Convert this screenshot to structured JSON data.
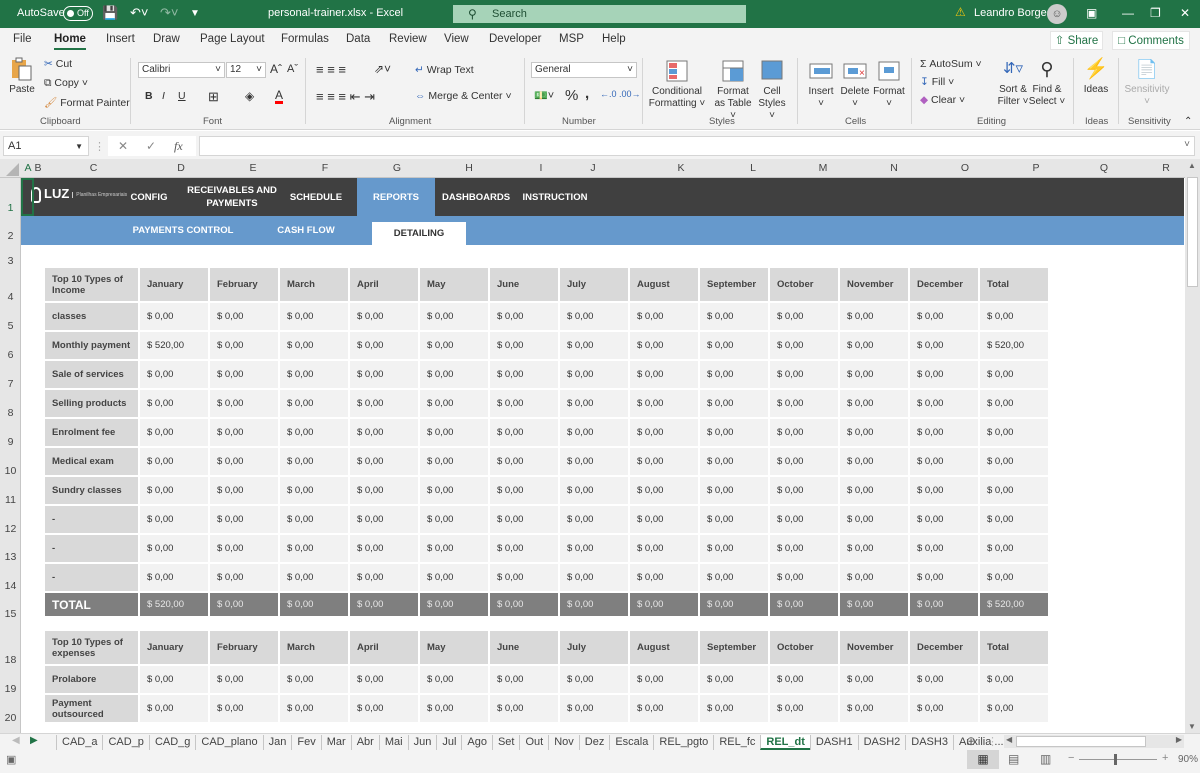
{
  "titlebar": {
    "autosave_label": "AutoSave",
    "autosave_state": "Off",
    "filename": "personal-trainer.xlsx  -  Excel",
    "search_placeholder": "Search",
    "user_name": "Leandro Borges"
  },
  "menu": {
    "tabs": [
      "File",
      "Home",
      "Insert",
      "Draw",
      "Page Layout",
      "Formulas",
      "Data",
      "Review",
      "View",
      "Developer",
      "MSP",
      "Help"
    ],
    "active": "Home",
    "share_label": "Share",
    "comments_label": "Comments"
  },
  "ribbon": {
    "clipboard": {
      "paste": "Paste",
      "cut": "Cut",
      "copy": "Copy",
      "format_painter": "Format Painter",
      "group": "Clipboard"
    },
    "font": {
      "name": "Calibri",
      "size": "12",
      "bold": "B",
      "italic": "I",
      "underline": "U",
      "group": "Font",
      "font_color": "#ff0000"
    },
    "alignment": {
      "wrap_text": "Wrap Text",
      "merge_center": "Merge & Center",
      "group": "Alignment"
    },
    "number": {
      "format": "General",
      "percent": "%",
      "comma": ",",
      "group": "Number"
    },
    "styles": {
      "conditional": "Conditional Formatting",
      "format_table": "Format as Table",
      "cell_styles": "Cell Styles",
      "group": "Styles"
    },
    "cells": {
      "insert": "Insert",
      "delete": "Delete",
      "format": "Format",
      "group": "Cells"
    },
    "editing": {
      "autosum": "AutoSum",
      "fill": "Fill",
      "clear": "Clear",
      "sort_filter": "Sort & Filter",
      "find_select": "Find & Select",
      "group": "Editing"
    },
    "ideas": {
      "label": "Ideas",
      "group": "Ideas"
    },
    "sensitivity": {
      "label": "Sensitivity",
      "group": "Sensitivity"
    }
  },
  "formula_bar": {
    "name_box": "A1",
    "fx": "fx",
    "value": ""
  },
  "columns": [
    "A",
    "B",
    "C",
    "D",
    "E",
    "F",
    "G",
    "H",
    "I",
    "J",
    "K",
    "L",
    "M",
    "N",
    "O",
    "P",
    "Q",
    "R"
  ],
  "rows": [
    "1",
    "2",
    "3",
    "4",
    "5",
    "6",
    "7",
    "8",
    "9",
    "10",
    "11",
    "12",
    "13",
    "14",
    "15",
    "18",
    "19",
    "20"
  ],
  "sheet_nav": {
    "logo": "LUZ",
    "logo_sub": "Planilhas Empresariais",
    "items": [
      "CONFIG",
      "RECEIVABLES AND PAYMENTS",
      "SCHEDULE",
      "REPORTS",
      "DASHBOARDS",
      "INSTRUCTION"
    ],
    "active": "REPORTS",
    "sub_items": [
      "PAYMENTS CONTROL",
      "CASH FLOW",
      "DETAILING"
    ],
    "sub_active": "DETAILING",
    "dark_color": "#404040",
    "accent_color": "#6699cc"
  },
  "income_table": {
    "title": "Top 10 Types of Income",
    "months": [
      "January",
      "February",
      "March",
      "April",
      "May",
      "June",
      "July",
      "August",
      "September",
      "October",
      "November",
      "December",
      "Total"
    ],
    "rows": [
      {
        "label": "classes",
        "values": [
          "$ 0,00",
          "$ 0,00",
          "$ 0,00",
          "$ 0,00",
          "$ 0,00",
          "$ 0,00",
          "$ 0,00",
          "$ 0,00",
          "$ 0,00",
          "$ 0,00",
          "$ 0,00",
          "$ 0,00",
          "$ 0,00"
        ]
      },
      {
        "label": "Monthly payment",
        "values": [
          "$ 520,00",
          "$ 0,00",
          "$ 0,00",
          "$ 0,00",
          "$ 0,00",
          "$ 0,00",
          "$ 0,00",
          "$ 0,00",
          "$ 0,00",
          "$ 0,00",
          "$ 0,00",
          "$ 0,00",
          "$ 520,00"
        ]
      },
      {
        "label": "Sale of services",
        "values": [
          "$ 0,00",
          "$ 0,00",
          "$ 0,00",
          "$ 0,00",
          "$ 0,00",
          "$ 0,00",
          "$ 0,00",
          "$ 0,00",
          "$ 0,00",
          "$ 0,00",
          "$ 0,00",
          "$ 0,00",
          "$ 0,00"
        ]
      },
      {
        "label": "Selling products",
        "values": [
          "$ 0,00",
          "$ 0,00",
          "$ 0,00",
          "$ 0,00",
          "$ 0,00",
          "$ 0,00",
          "$ 0,00",
          "$ 0,00",
          "$ 0,00",
          "$ 0,00",
          "$ 0,00",
          "$ 0,00",
          "$ 0,00"
        ]
      },
      {
        "label": "Enrolment fee",
        "values": [
          "$ 0,00",
          "$ 0,00",
          "$ 0,00",
          "$ 0,00",
          "$ 0,00",
          "$ 0,00",
          "$ 0,00",
          "$ 0,00",
          "$ 0,00",
          "$ 0,00",
          "$ 0,00",
          "$ 0,00",
          "$ 0,00"
        ]
      },
      {
        "label": "Medical exam",
        "values": [
          "$ 0,00",
          "$ 0,00",
          "$ 0,00",
          "$ 0,00",
          "$ 0,00",
          "$ 0,00",
          "$ 0,00",
          "$ 0,00",
          "$ 0,00",
          "$ 0,00",
          "$ 0,00",
          "$ 0,00",
          "$ 0,00"
        ]
      },
      {
        "label": "Sundry classes",
        "values": [
          "$ 0,00",
          "$ 0,00",
          "$ 0,00",
          "$ 0,00",
          "$ 0,00",
          "$ 0,00",
          "$ 0,00",
          "$ 0,00",
          "$ 0,00",
          "$ 0,00",
          "$ 0,00",
          "$ 0,00",
          "$ 0,00"
        ]
      },
      {
        "label": "-",
        "values": [
          "$ 0,00",
          "$ 0,00",
          "$ 0,00",
          "$ 0,00",
          "$ 0,00",
          "$ 0,00",
          "$ 0,00",
          "$ 0,00",
          "$ 0,00",
          "$ 0,00",
          "$ 0,00",
          "$ 0,00",
          "$ 0,00"
        ]
      },
      {
        "label": "-",
        "values": [
          "$ 0,00",
          "$ 0,00",
          "$ 0,00",
          "$ 0,00",
          "$ 0,00",
          "$ 0,00",
          "$ 0,00",
          "$ 0,00",
          "$ 0,00",
          "$ 0,00",
          "$ 0,00",
          "$ 0,00",
          "$ 0,00"
        ]
      },
      {
        "label": "-",
        "values": [
          "$ 0,00",
          "$ 0,00",
          "$ 0,00",
          "$ 0,00",
          "$ 0,00",
          "$ 0,00",
          "$ 0,00",
          "$ 0,00",
          "$ 0,00",
          "$ 0,00",
          "$ 0,00",
          "$ 0,00",
          "$ 0,00"
        ]
      }
    ],
    "total": {
      "label": "TOTAL",
      "values": [
        "$ 520,00",
        "$ 0,00",
        "$ 0,00",
        "$ 0,00",
        "$ 0,00",
        "$ 0,00",
        "$ 0,00",
        "$ 0,00",
        "$ 0,00",
        "$ 0,00",
        "$ 0,00",
        "$ 0,00",
        "$ 520,00"
      ]
    }
  },
  "expense_table": {
    "title": "Top 10 Types of expenses",
    "months": [
      "January",
      "February",
      "March",
      "April",
      "May",
      "June",
      "July",
      "August",
      "September",
      "October",
      "November",
      "December",
      "Total"
    ],
    "rows": [
      {
        "label": "Prolabore",
        "values": [
          "$ 0,00",
          "$ 0,00",
          "$ 0,00",
          "$ 0,00",
          "$ 0,00",
          "$ 0,00",
          "$ 0,00",
          "$ 0,00",
          "$ 0,00",
          "$ 0,00",
          "$ 0,00",
          "$ 0,00",
          "$ 0,00"
        ]
      },
      {
        "label": "Payment outsourced",
        "values": [
          "$ 0,00",
          "$ 0,00",
          "$ 0,00",
          "$ 0,00",
          "$ 0,00",
          "$ 0,00",
          "$ 0,00",
          "$ 0,00",
          "$ 0,00",
          "$ 0,00",
          "$ 0,00",
          "$ 0,00",
          "$ 0,00"
        ]
      }
    ]
  },
  "sheet_tabs": {
    "tabs": [
      "CAD_a",
      "CAD_p",
      "CAD_g",
      "CAD_plano",
      "Jan",
      "Fev",
      "Mar",
      "Abr",
      "Mai",
      "Jun",
      "Jul",
      "Ago",
      "Set",
      "Out",
      "Nov",
      "Dez",
      "Escala",
      "REL_pgto",
      "REL_fc",
      "REL_dt",
      "DASH1",
      "DASH2",
      "DASH3",
      "Auxilia ..."
    ],
    "active": "REL_dt"
  },
  "status": {
    "zoom": "90%",
    "zoom_fraction": 0.9
  }
}
